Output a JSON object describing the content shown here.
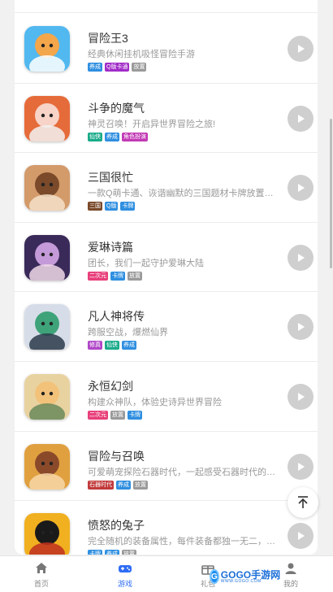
{
  "colors": {
    "accent": "#2e6cf5",
    "play_button": "#cfcfcf",
    "background": "#f1f1f1"
  },
  "games": [
    {
      "title": "冒险王3",
      "desc": "经典休闲挂机吸怪冒险手游",
      "tags": [
        {
          "text": "养成",
          "color": "#2f8fe0"
        },
        {
          "text": "Q版卡通",
          "color": "#a12cc8"
        },
        {
          "text": "放置",
          "color": "#9a9a9a"
        }
      ],
      "icon": "mushroom-hero-icon",
      "palette": [
        "#52b8f0",
        "#f3a64a",
        "#ffffff"
      ]
    },
    {
      "title": "斗争的魔气",
      "desc": "神灵召唤！开启异世界冒险之旅!",
      "tags": [
        {
          "text": "仙侠",
          "color": "#1bab8a"
        },
        {
          "text": "养成",
          "color": "#2f8fe0"
        },
        {
          "text": "角色扮演",
          "color": "#c23ab5"
        }
      ],
      "icon": "fox-girl-icon",
      "palette": [
        "#e66b3a",
        "#f7d3c8",
        "#f2f2f2"
      ]
    },
    {
      "title": "三国很忙",
      "desc": "一款Q萌卡通、诙谐幽默的三国题材卡牌放置挂机手游",
      "tags": [
        {
          "text": "三国",
          "color": "#7a4a2a"
        },
        {
          "text": "Q版",
          "color": "#2f8fe0"
        },
        {
          "text": "卡牌",
          "color": "#2f8fe0"
        }
      ],
      "icon": "bear-girl-icon",
      "palette": [
        "#d39a6a",
        "#7a4a2a",
        "#f4e0c8"
      ]
    },
    {
      "title": "爱琳诗篇",
      "desc": "团长，我们一起守护爱琳大陆",
      "tags": [
        {
          "text": "二次元",
          "color": "#e8407a"
        },
        {
          "text": "卡牌",
          "color": "#2f8fe0"
        },
        {
          "text": "放置",
          "color": "#9a9a9a"
        }
      ],
      "icon": "dark-heroine-icon",
      "palette": [
        "#3a2a5a",
        "#c49ad8",
        "#f0d8e8"
      ]
    },
    {
      "title": "凡人神将传",
      "desc": "跨服空战，爆燃仙界",
      "tags": [
        {
          "text": "修真",
          "color": "#b046c8"
        },
        {
          "text": "仙侠",
          "color": "#1bab8a"
        },
        {
          "text": "养成",
          "color": "#2f8fe0"
        }
      ],
      "icon": "immortal-warrior-icon",
      "palette": [
        "#d7dde8",
        "#3fa37a",
        "#2a3a4a"
      ]
    },
    {
      "title": "永恒幻剑",
      "desc": "构建众神队，体验史诗异世界冒险",
      "tags": [
        {
          "text": "二次元",
          "color": "#e8407a"
        },
        {
          "text": "放置",
          "color": "#9a9a9a"
        },
        {
          "text": "卡牌",
          "color": "#2f8fe0"
        }
      ],
      "icon": "blonde-knight-icon",
      "palette": [
        "#e8d2a0",
        "#f3c27a",
        "#6a8a5a"
      ]
    },
    {
      "title": "冒险与召唤",
      "desc": "可爱萌宠探险石器时代，一起感受石器时代的乐趣",
      "tags": [
        {
          "text": "石器时代",
          "color": "#c23a3a"
        },
        {
          "text": "养成",
          "color": "#2f8fe0"
        },
        {
          "text": "放置",
          "color": "#9a9a9a"
        }
      ],
      "icon": "caveman-icon",
      "palette": [
        "#e0a040",
        "#8a4a2a",
        "#f7d8a8"
      ]
    },
    {
      "title": "愤怒的兔子",
      "desc": "完全随机的装备属性，每件装备都独一无二，快来体验吧",
      "tags": [
        {
          "text": "卡牌",
          "color": "#2f8fe0"
        },
        {
          "text": "养成",
          "color": "#2f8fe0"
        },
        {
          "text": "放置",
          "color": "#9a9a9a"
        }
      ],
      "icon": "shadow-rabbit-icon",
      "palette": [
        "#f0b020",
        "#1a1a1a",
        "#c03020"
      ]
    }
  ],
  "tabbar": {
    "tabs": [
      {
        "label": "首页",
        "icon": "home-icon"
      },
      {
        "label": "游戏",
        "icon": "gamepad-icon"
      },
      {
        "label": "礼包",
        "icon": "gift-icon"
      },
      {
        "label": "",
        "icon": ""
      },
      {
        "label": "我的",
        "icon": "user-icon"
      }
    ],
    "active_index": 1
  },
  "watermark": {
    "main": "GOGO手游网",
    "sub": "WWW.GOGO.COM"
  }
}
